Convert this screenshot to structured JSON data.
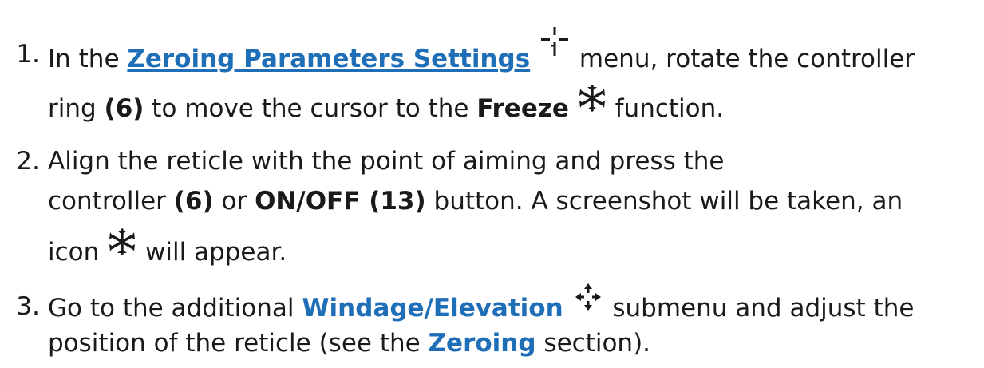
{
  "steps": [
    {
      "number": "1.",
      "line1": {
        "pre": "In the ",
        "link": "Zeroing Parameters Settings",
        "post": " menu, rotate the controller"
      },
      "line2": {
        "pre": "ring ",
        "bold1": "(6)",
        "mid": " to move the cursor to the ",
        "bold2": "Freeze",
        "post": " function."
      },
      "icons": [
        "zeroing-reticle-icon",
        "freeze-snowflake-icon"
      ]
    },
    {
      "number": "2.",
      "line1": {
        "text": "Align the reticle with the point of aiming and press the"
      },
      "line2": {
        "pre": "controller ",
        "bold1": "(6)",
        "mid": " or ",
        "bold2": "ON/OFF (13)",
        "post": " button. A screenshot will be taken, an"
      },
      "line3": {
        "pre": "icon",
        "post": " will appear."
      },
      "icons": [
        "freeze-snowflake-icon"
      ]
    },
    {
      "number": "3.",
      "line1": {
        "pre": "Go to the additional ",
        "link": "Windage/Elevation",
        "post": " submenu and adjust the"
      },
      "line2": {
        "pre": "position of the reticle (see the ",
        "link": "Zeroing",
        "post": " section)."
      },
      "icons": [
        "windage-elevation-arrows-icon"
      ]
    }
  ],
  "colors": {
    "text": "#1a1a1a",
    "link": "#1f6fb8"
  }
}
